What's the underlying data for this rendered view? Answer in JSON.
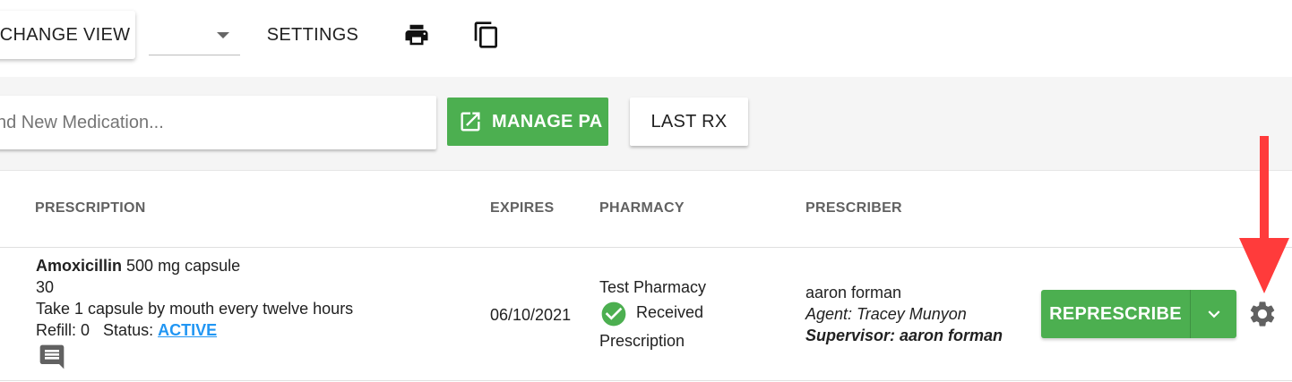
{
  "toolbar": {
    "change_view_label": "CHANGE VIEW",
    "select_value": "",
    "settings_label": "SETTINGS",
    "print_icon": "print-icon",
    "copy_icon": "copy-icon"
  },
  "actionbar": {
    "search_placeholder": "nd New Medication...",
    "manage_pa_label": "MANAGE PA",
    "last_rx_label": "LAST RX"
  },
  "table": {
    "headers": {
      "prescription": "PRESCRIPTION",
      "expires": "EXPIRES",
      "pharmacy": "PHARMACY",
      "prescriber": "PRESCRIBER"
    },
    "row": {
      "med_name": "Amoxicillin",
      "med_strength": " 500 mg capsule",
      "quantity": "30",
      "sig": "Take 1 capsule by mouth every twelve hours",
      "refill_label": "Refill: 0",
      "status_label": "Status: ",
      "status_value": "ACTIVE",
      "expires": "06/10/2021",
      "pharmacy_name": "Test Pharmacy",
      "pharmacy_status_line1": "Received",
      "pharmacy_status_line2": "Prescription",
      "prescriber": "aaron forman",
      "agent": "Agent: Tracey Munyon",
      "supervisor": "Supervisor: aaron forman",
      "represcribe_label": "REPRESCRIBE"
    }
  },
  "colors": {
    "primary_green": "#4caf50",
    "link_blue": "#2196f3",
    "annotation_red": "#ff3b3b"
  }
}
